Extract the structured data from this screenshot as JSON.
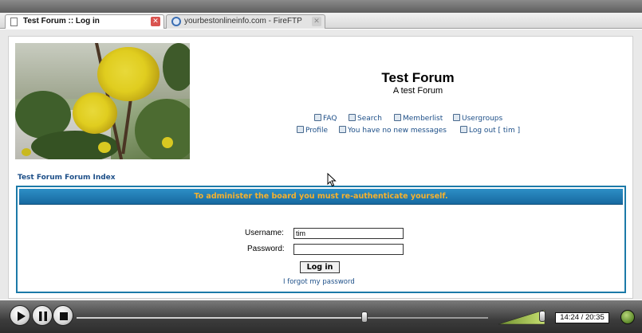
{
  "browser": {
    "tabs": [
      {
        "label": "Test Forum :: Log in",
        "active": true
      },
      {
        "label": "yourbestonlineinfo.com - FireFTP",
        "active": false
      }
    ]
  },
  "forum": {
    "title": "Test Forum",
    "description": "A test Forum",
    "nav": {
      "faq": "FAQ",
      "search": "Search",
      "memberlist": "Memberlist",
      "usergroups": "Usergroups",
      "profile": "Profile",
      "messages": "You have no new messages",
      "logout": "Log out [ tim ]"
    },
    "breadcrumb": "Test Forum Forum Index"
  },
  "login": {
    "header": "To administer the board you must re-authenticate yourself.",
    "username_label": "Username:",
    "username_value": "tim",
    "password_label": "Password:",
    "password_value": "",
    "submit_label": "Log in",
    "forgot_link": "I forgot my password"
  },
  "player": {
    "time": "14:24 / 20:35",
    "progress": 0.7,
    "volume": 0.9
  },
  "colors": {
    "link": "#1d4f88",
    "panel_header": "#1c7aa8",
    "panel_header_text": "#f7b22d"
  }
}
